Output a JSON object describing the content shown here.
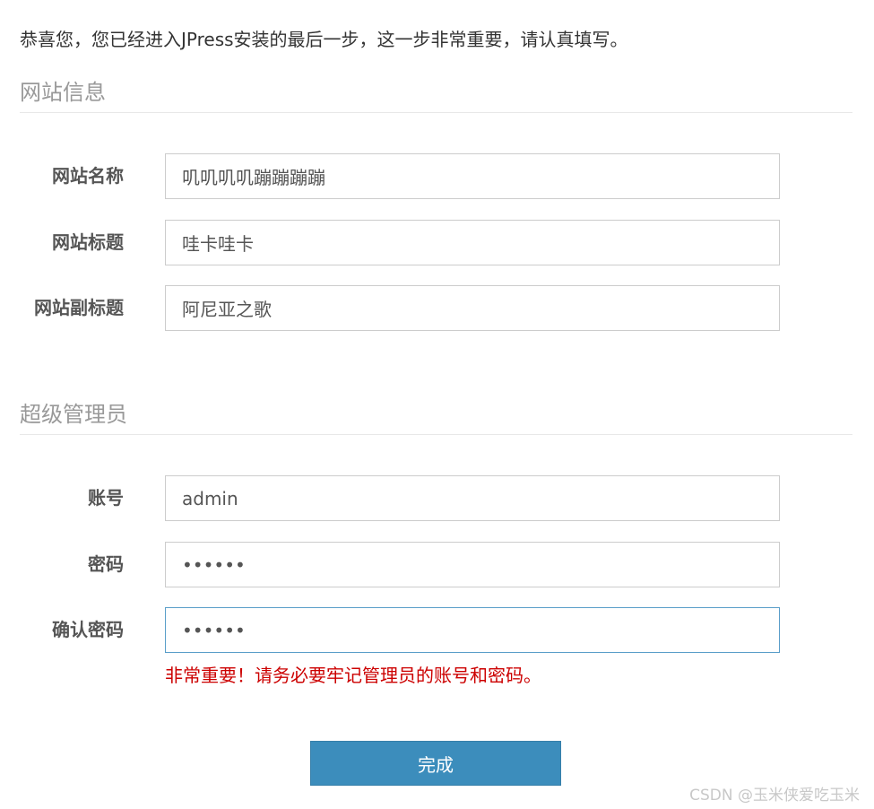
{
  "intro_text": "恭喜您，您已经进入JPress安装的最后一步，这一步非常重要，请认真填写。",
  "site_section": {
    "title": "网站信息",
    "fields": {
      "name": {
        "label": "网站名称",
        "value": "叽叽叽叽蹦蹦蹦蹦"
      },
      "title": {
        "label": "网站标题",
        "value": "哇卡哇卡"
      },
      "subtitle": {
        "label": "网站副标题",
        "value": "阿尼亚之歌"
      }
    }
  },
  "admin_section": {
    "title": "超级管理员",
    "fields": {
      "account": {
        "label": "账号",
        "value": "admin"
      },
      "password": {
        "label": "密码",
        "value": "••••••"
      },
      "confirm_password": {
        "label": "确认密码",
        "value": "••••••"
      }
    }
  },
  "warning_text": "非常重要！请务必要牢记管理员的账号和密码。",
  "submit_label": "完成",
  "watermark": "CSDN @玉米侠爱吃玉米",
  "colors": {
    "primary_button": "#3c8dbc",
    "warning": "#cc0000",
    "focus_border": "#5a9ec9"
  }
}
